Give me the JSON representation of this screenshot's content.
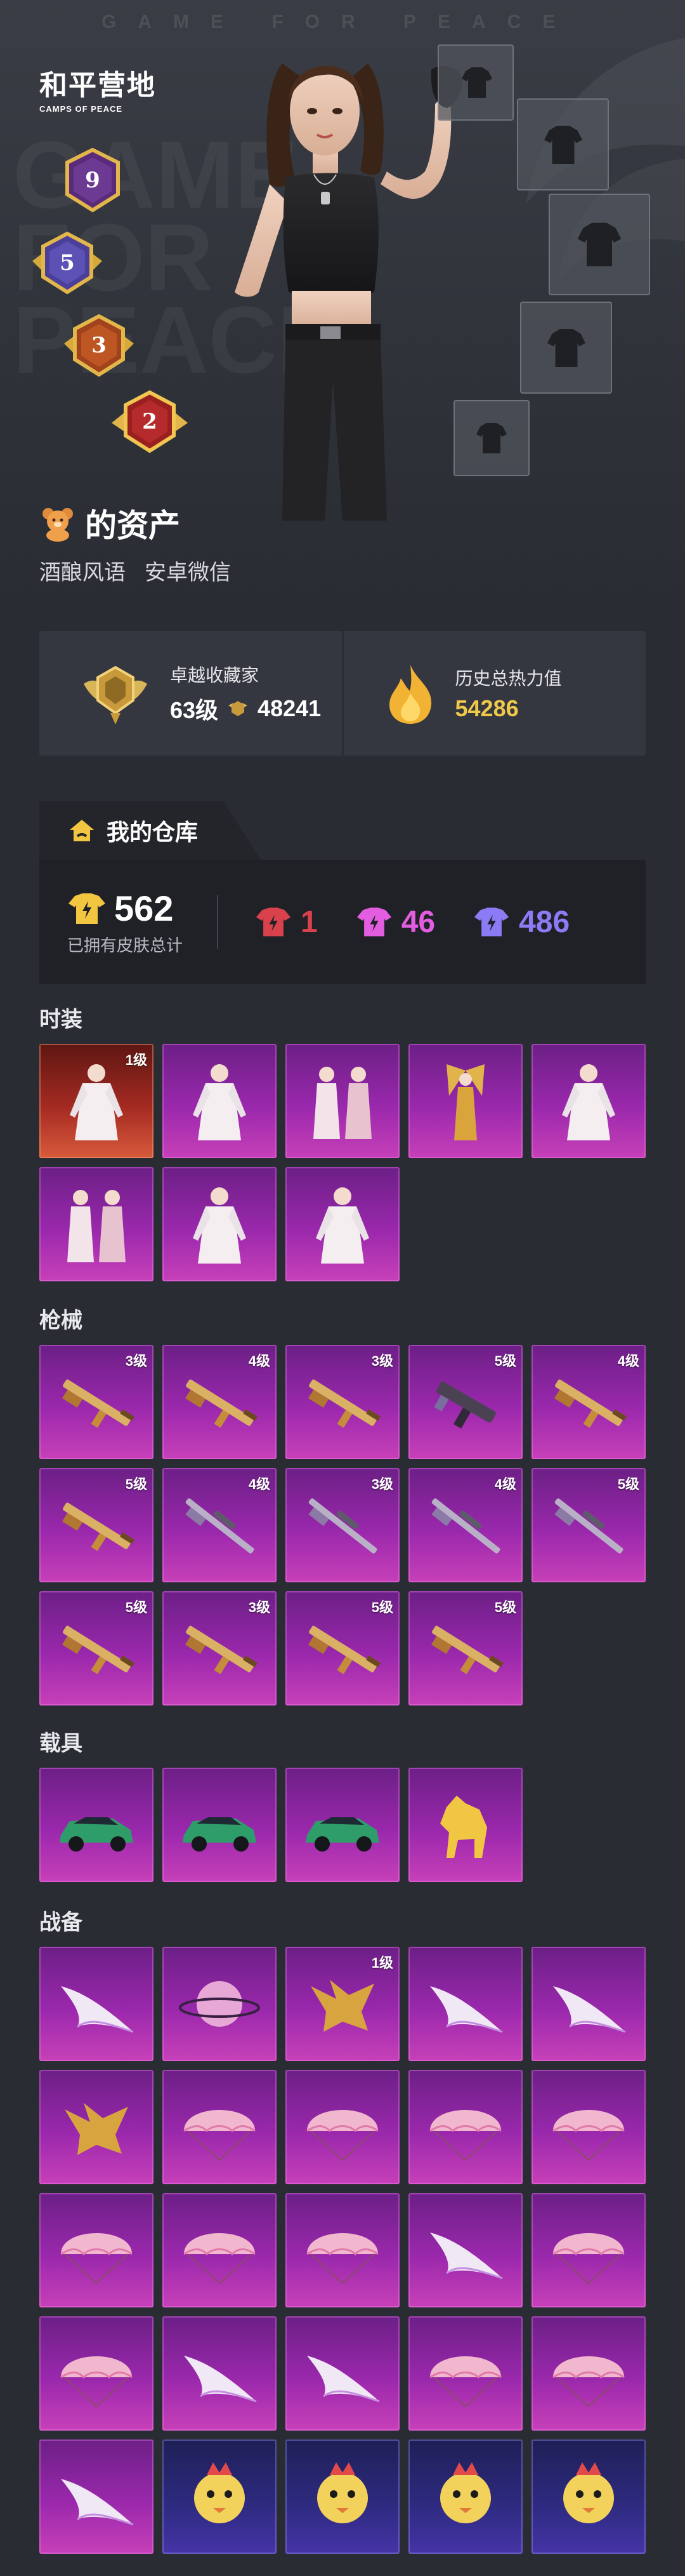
{
  "hero": {
    "watermark": "GAME FOR PEACE",
    "bigtext_lines": [
      "GAME",
      "FOR",
      "PEACE"
    ],
    "logo_main": "和平营地",
    "logo_sub": "CAMPS OF PEACE",
    "rank_badges": [
      "9",
      "5",
      "3",
      "2"
    ],
    "owner_title": "的资产",
    "owner_name": "酒酿风语",
    "owner_platform": "安卓微信"
  },
  "stats": {
    "collector_label": "卓越收藏家",
    "collector_level": "63级",
    "collector_points": "48241",
    "heat_label": "历史总热力值",
    "heat_value": "54286"
  },
  "warehouse": {
    "tab_label": "我的仓库",
    "total_skins": "562",
    "total_caption": "已拥有皮肤总计",
    "tier_red": "1",
    "tier_purple": "46",
    "tier_blue": "486",
    "colors": {
      "red": "#d9414c",
      "purple": "#e35de0",
      "blue": "#8b7cf5"
    }
  },
  "sections": {
    "fashion": {
      "title": "时装",
      "items": [
        {
          "level": "1级",
          "icon": "outfit-icon"
        },
        {
          "level": "",
          "icon": "outfit-icon"
        },
        {
          "level": "",
          "icon": "couple-outfit-icon"
        },
        {
          "level": "",
          "icon": "winged-outfit-icon"
        },
        {
          "level": "",
          "icon": "outfit-icon"
        },
        {
          "level": "",
          "icon": "couple-outfit-icon"
        },
        {
          "level": "",
          "icon": "outfit-icon"
        },
        {
          "level": "",
          "icon": "outfit-icon"
        }
      ]
    },
    "guns": {
      "title": "枪械",
      "items": [
        {
          "level": "3级",
          "icon": "rifle-icon"
        },
        {
          "level": "4级",
          "icon": "rifle-icon"
        },
        {
          "level": "3级",
          "icon": "rifle-icon"
        },
        {
          "level": "5级",
          "icon": "smg-icon"
        },
        {
          "level": "4级",
          "icon": "rifle-icon"
        },
        {
          "level": "5级",
          "icon": "rifle-icon"
        },
        {
          "level": "4级",
          "icon": "sniper-icon"
        },
        {
          "level": "3级",
          "icon": "sniper-icon"
        },
        {
          "level": "4级",
          "icon": "sniper-icon"
        },
        {
          "level": "5级",
          "icon": "sniper-icon"
        },
        {
          "level": "5级",
          "icon": "rifle-icon"
        },
        {
          "level": "3级",
          "icon": "rifle-icon"
        },
        {
          "level": "5级",
          "icon": "rifle-icon"
        },
        {
          "level": "5级",
          "icon": "rifle-icon"
        }
      ]
    },
    "vehicles": {
      "title": "载具",
      "items": [
        {
          "level": "",
          "icon": "car-icon"
        },
        {
          "level": "",
          "icon": "car-icon"
        },
        {
          "level": "",
          "icon": "car-icon"
        },
        {
          "level": "",
          "icon": "golden-horse-icon"
        }
      ]
    },
    "gear": {
      "title": "战备",
      "items": [
        {
          "level": "",
          "icon": "glider-icon"
        },
        {
          "level": "",
          "icon": "planet-icon"
        },
        {
          "level": "1级",
          "icon": "dragon-icon"
        },
        {
          "level": "",
          "icon": "glider-icon"
        },
        {
          "level": "",
          "icon": "glider-icon"
        },
        {
          "level": "",
          "icon": "dragon-icon"
        },
        {
          "level": "",
          "icon": "parachute-icon"
        },
        {
          "level": "",
          "icon": "parachute-icon"
        },
        {
          "level": "",
          "icon": "parachute-icon"
        },
        {
          "level": "",
          "icon": "parachute-icon"
        },
        {
          "level": "",
          "icon": "parachute-icon"
        },
        {
          "level": "",
          "icon": "parachute-icon"
        },
        {
          "level": "",
          "icon": "parachute-icon"
        },
        {
          "level": "",
          "icon": "glider-icon"
        },
        {
          "level": "",
          "icon": "parachute-icon"
        },
        {
          "level": "",
          "icon": "parachute-icon"
        },
        {
          "level": "",
          "icon": "glider-icon"
        },
        {
          "level": "",
          "icon": "glider-icon"
        },
        {
          "level": "",
          "icon": "parachute-icon"
        },
        {
          "level": "",
          "icon": "parachute-icon"
        },
        {
          "level": "",
          "icon": "glider-icon"
        },
        {
          "level": "",
          "icon": "pet-icon"
        },
        {
          "level": "",
          "icon": "pet-icon"
        },
        {
          "level": "",
          "icon": "pet-icon"
        },
        {
          "level": "",
          "icon": "pet-icon"
        }
      ]
    }
  }
}
